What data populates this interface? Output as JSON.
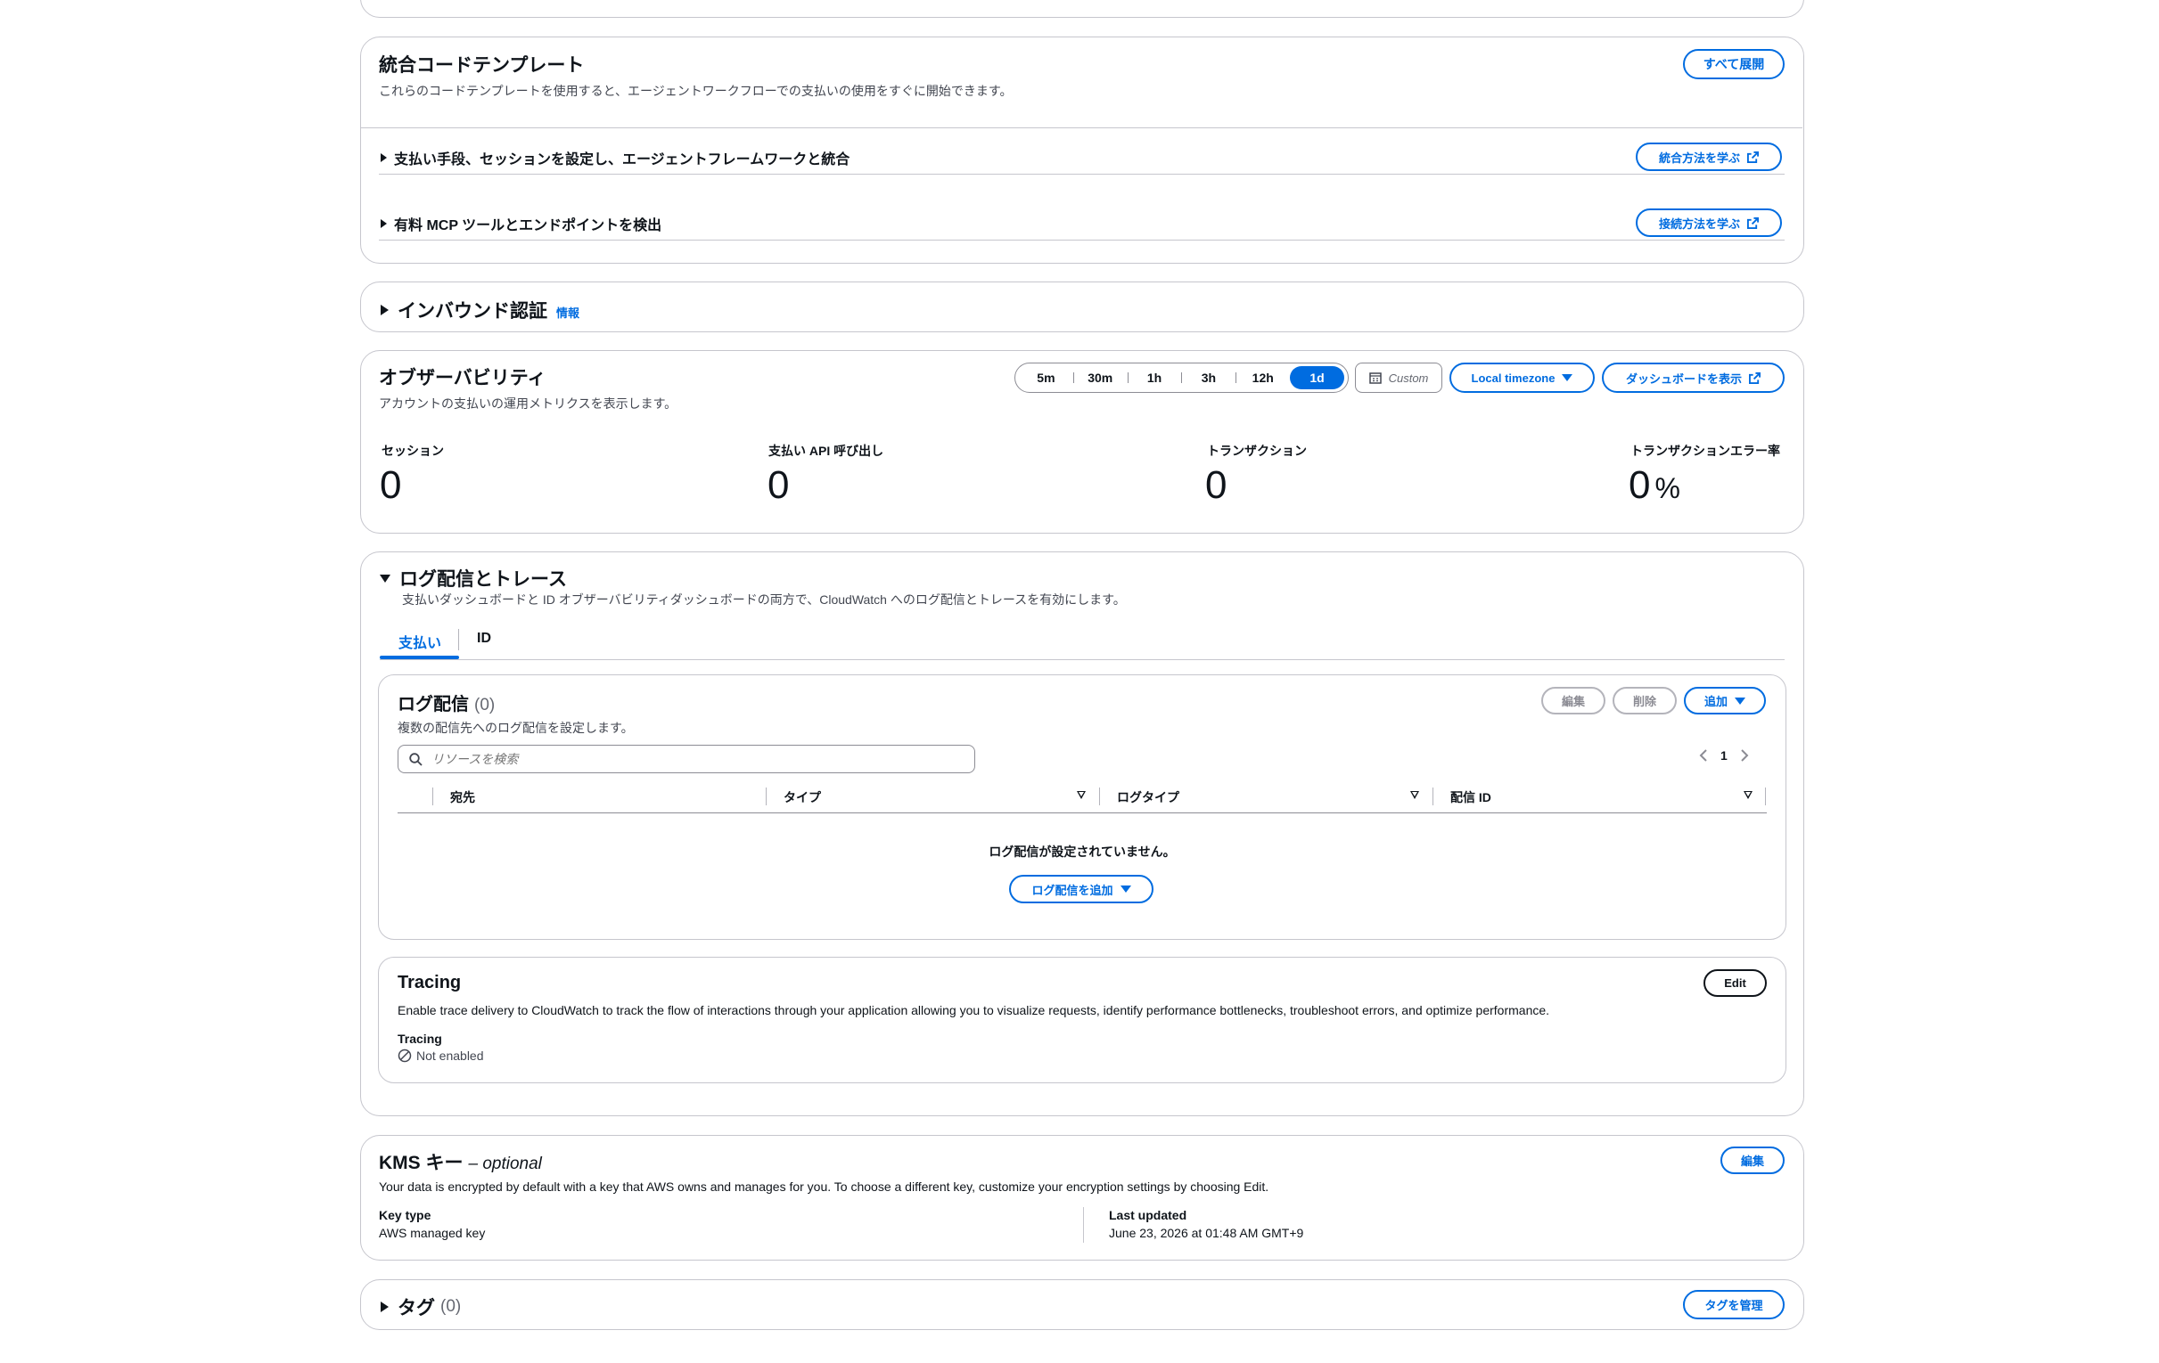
{
  "integration": {
    "title": "統合コードテンプレート",
    "description": "これらのコードテンプレートを使用すると、エージェントワークフローでの支払いの使用をすぐに開始できます。",
    "expand_all": "すべて展開",
    "items": [
      {
        "label": "支払い手段、セッションを設定し、エージェントフレームワークと統合",
        "link": "統合方法を学ぶ"
      },
      {
        "label": "有料 MCP ツールとエンドポイントを検出",
        "link": "接続方法を学ぶ"
      }
    ]
  },
  "inbound": {
    "title": "インバウンド認証",
    "info": "情報"
  },
  "observability": {
    "title": "オブザーバビリティ",
    "description": "アカウントの支払いの運用メトリクスを表示します。",
    "ranges": [
      "5m",
      "30m",
      "1h",
      "3h",
      "12h",
      "1d"
    ],
    "active_range": "1d",
    "custom": "Custom",
    "timezone": "Local timezone",
    "dashboard": "ダッシュボードを表示",
    "metrics": [
      {
        "label": "セッション",
        "value": "0"
      },
      {
        "label": "支払い API 呼び出し",
        "value": "0"
      },
      {
        "label": "トランザクション",
        "value": "0"
      },
      {
        "label": "トランザクションエラー率",
        "value": "0",
        "unit": "%"
      }
    ]
  },
  "logs": {
    "title": "ログ配信とトレース",
    "description": "支払いダッシュボードと ID オブザーバビリティダッシュボードの両方で、CloudWatch へのログ配信とトレースを有効にします。",
    "tabs": [
      "支払い",
      "ID"
    ],
    "delivery": {
      "title": "ログ配信",
      "count": "(0)",
      "description": "複数の配信先へのログ配信を設定します。",
      "edit": "編集",
      "delete": "削除",
      "add": "追加",
      "search_placeholder": "リソースを検索",
      "page": "1",
      "columns": [
        "宛先",
        "タイプ",
        "ログタイプ",
        "配信 ID"
      ],
      "empty": "ログ配信が設定されていません。",
      "add_delivery": "ログ配信を追加"
    },
    "tracing": {
      "title": "Tracing",
      "edit": "Edit",
      "description": "Enable trace delivery to CloudWatch to track the flow of interactions through your application allowing you to visualize requests, identify performance bottlenecks, troubleshoot errors, and optimize performance.",
      "label": "Tracing",
      "status": "Not enabled"
    }
  },
  "kms": {
    "title": "KMS キー",
    "optional": "– optional",
    "edit": "編集",
    "description": "Your data is encrypted by default with a key that AWS owns and manages for you. To choose a different key, customize your encryption settings by choosing Edit.",
    "key_type_label": "Key type",
    "key_type_value": "AWS managed key",
    "updated_label": "Last updated",
    "updated_value": "June 23, 2026 at 01:48 AM GMT+9"
  },
  "tags": {
    "title": "タグ",
    "count": "(0)",
    "manage": "タグを管理"
  },
  "colors": {
    "accent": "#006ce0",
    "border": "#c6c6cd",
    "text": "#0f141a"
  }
}
